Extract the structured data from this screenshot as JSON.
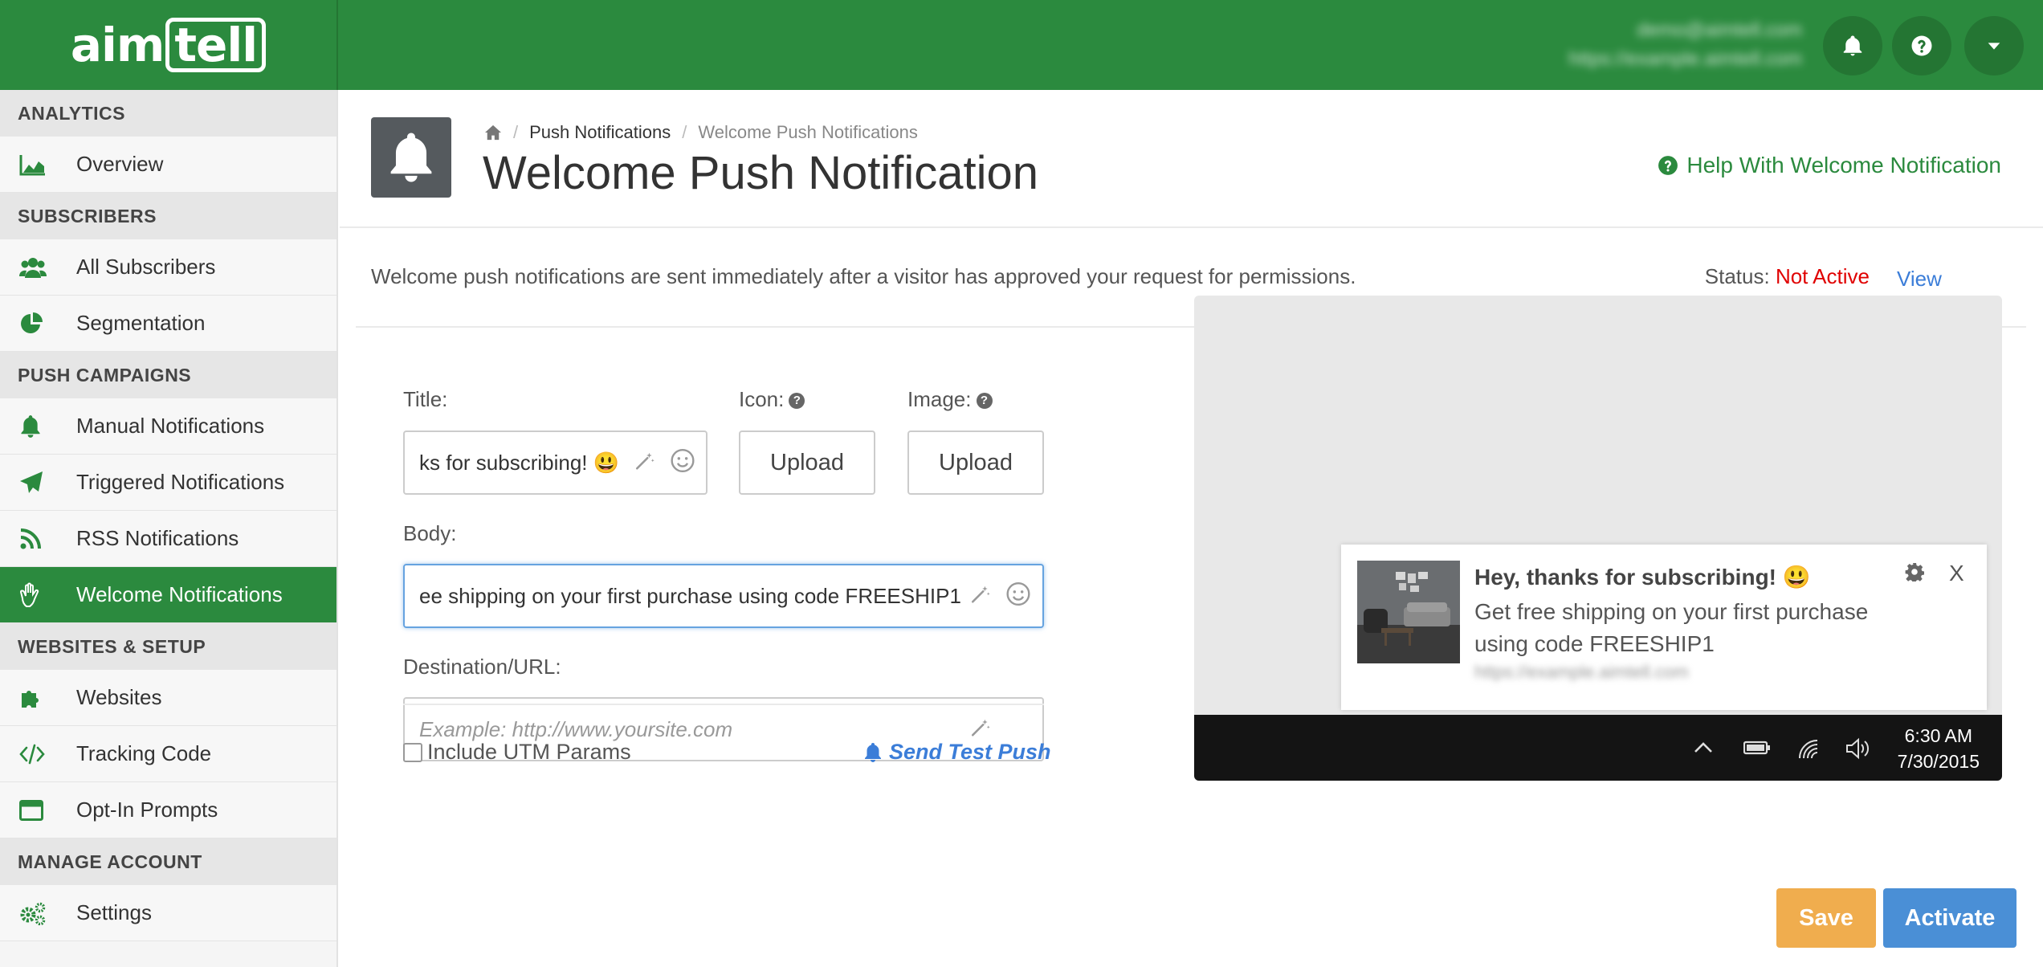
{
  "header": {
    "logo_prefix": "aim",
    "logo_box": "tell",
    "user_email": "demo@aimtell.com",
    "user_site": "https://example.aimtell.com"
  },
  "sidebar": {
    "sections": [
      {
        "title": "ANALYTICS",
        "items": [
          {
            "label": "Overview",
            "icon": "area-chart-icon"
          }
        ]
      },
      {
        "title": "SUBSCRIBERS",
        "items": [
          {
            "label": "All Subscribers",
            "icon": "users-icon"
          },
          {
            "label": "Segmentation",
            "icon": "pie-chart-icon"
          }
        ]
      },
      {
        "title": "PUSH CAMPAIGNS",
        "items": [
          {
            "label": "Manual Notifications",
            "icon": "bell-icon"
          },
          {
            "label": "Triggered Notifications",
            "icon": "paper-plane-icon"
          },
          {
            "label": "RSS Notifications",
            "icon": "rss-icon"
          },
          {
            "label": "Welcome Notifications",
            "icon": "hand-wave-icon"
          }
        ]
      },
      {
        "title": "WEBSITES & SETUP",
        "items": [
          {
            "label": "Websites",
            "icon": "puzzle-icon"
          },
          {
            "label": "Tracking Code",
            "icon": "code-icon"
          },
          {
            "label": "Opt-In Prompts",
            "icon": "window-icon"
          }
        ]
      },
      {
        "title": "MANAGE ACCOUNT",
        "items": [
          {
            "label": "Settings",
            "icon": "gears-icon"
          }
        ]
      }
    ],
    "active_item": "Welcome Notifications"
  },
  "page": {
    "breadcrumb": [
      "Push Notifications",
      "Welcome Push Notifications"
    ],
    "title": "Welcome Push Notification",
    "help_link": "Help With Welcome Notification",
    "description": "Welcome push notifications are sent immediately after a visitor has approved your request for permissions.",
    "status_label": "Status:",
    "status_value": "Not Active",
    "view_results": "View Results"
  },
  "form": {
    "title_label": "Title:",
    "title_value": "ks for subscribing! 😃",
    "icon_label": "Icon:",
    "image_label": "Image:",
    "upload_label": "Upload",
    "body_label": "Body:",
    "body_value": "ee shipping on your first purchase using code FREESHIP1",
    "url_label": "Destination/URL:",
    "url_placeholder": "Example: http://www.yoursite.com",
    "utm_label": "Include UTM Params",
    "utm_checked": false,
    "send_test_label": "Send Test Push"
  },
  "preview": {
    "title": "Hey, thanks for subscribing! 😃",
    "body": "Get free shipping on your first purchase using code FREESHIP1",
    "url": "https://example.aimtell.com",
    "close": "X",
    "time": "6:30 AM",
    "date": "7/30/2015"
  },
  "actions": {
    "save_label": "Save",
    "activate_label": "Activate"
  },
  "colors": {
    "brand_green": "#2b8a3e",
    "status_inactive": "#e00000",
    "link_blue": "#3b7dd8",
    "save_orange": "#f0ad4e",
    "activate_blue": "#4a8fd6"
  }
}
